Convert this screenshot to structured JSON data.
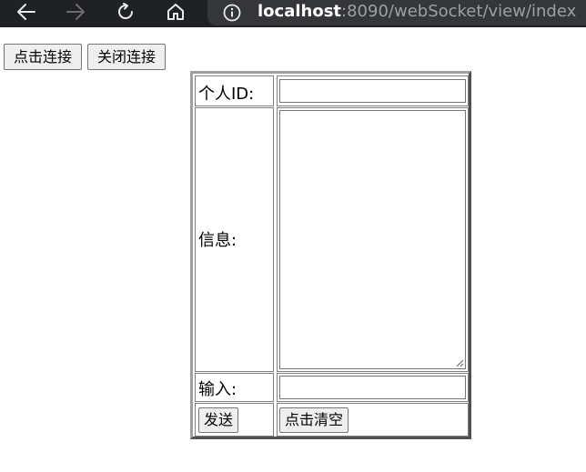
{
  "browser": {
    "url_host": "localhost",
    "url_rest": ":8090/webSocket/view/index",
    "icons": [
      "back-arrow-icon",
      "forward-arrow-icon",
      "reload-icon",
      "home-icon",
      "info-icon"
    ],
    "chrome_color": "#202124",
    "urlbar_color": "#35363a"
  },
  "controls": {
    "connect_label": "点击连接",
    "disconnect_label": "关闭连接"
  },
  "form": {
    "id_label": "个人ID:",
    "id_value": "",
    "message_label": "信息:",
    "message_value": "",
    "input_label": "输入:",
    "input_value": "",
    "send_label": "发送",
    "clear_label": "点击清空"
  }
}
